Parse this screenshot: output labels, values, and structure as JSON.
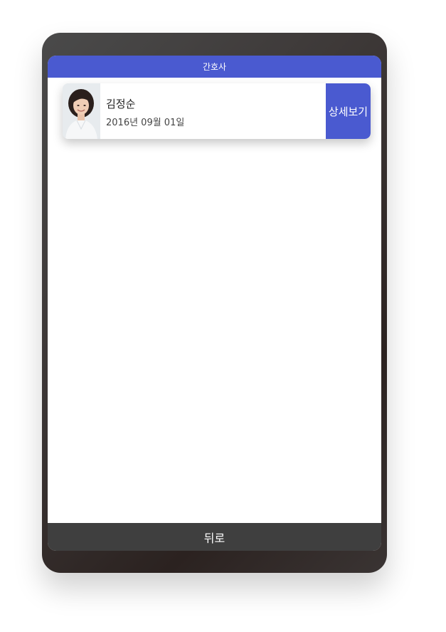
{
  "header": {
    "title": "간호사"
  },
  "list": {
    "items": [
      {
        "name": "김정순",
        "date": "2016년 09월 01일",
        "detail_label": "상세보기"
      }
    ]
  },
  "footer": {
    "back_label": "뒤로"
  },
  "colors": {
    "accent": "#4a5ad0",
    "footer": "#3f3f3f",
    "device": "#3a3433"
  },
  "icons": {
    "avatar": "nurse-photo"
  }
}
